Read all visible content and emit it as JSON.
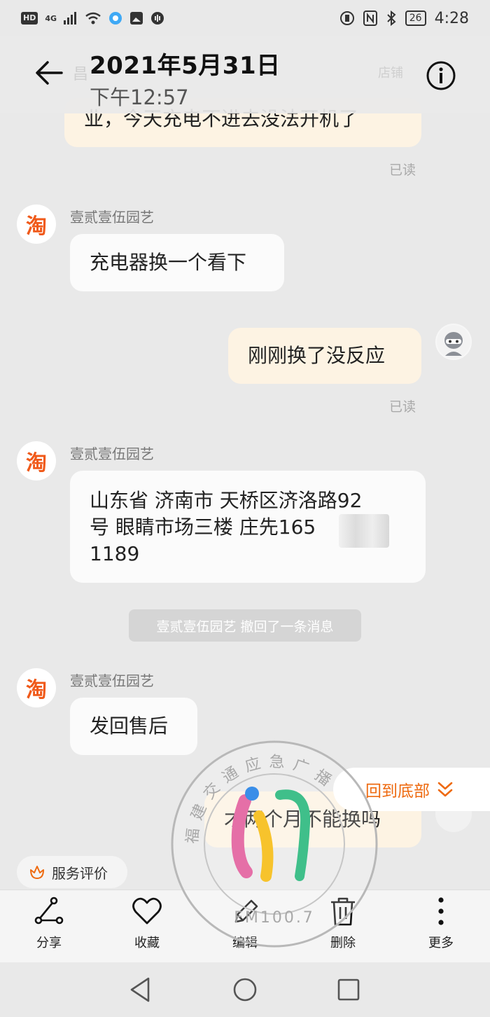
{
  "status_bar": {
    "left_chips": [
      "HD",
      "4G"
    ],
    "battery": "26",
    "time": "4:28"
  },
  "header": {
    "title": "2021年5月31日",
    "subtitle": "下午12:57",
    "faded_name": "昌",
    "faded_right": "店铺"
  },
  "messages": {
    "m0_text": "业，今天充电不进去没法开机了",
    "m0_status": "已读",
    "m1_sender": "壹贰壹伍园艺",
    "m1_text": "充电器换一个看下",
    "m2_text": "刚刚换了没反应",
    "m2_status": "已读",
    "m3_sender": "壹贰壹伍园艺",
    "m3_line1": "山东省 济南市 天桥区济洛路92",
    "m3_line2": "号 眼睛市场三楼 庄先165",
    "m3_line3": "1189",
    "recall_notice": "壹贰壹伍园艺 撤回了一条消息",
    "m4_sender": "壹贰壹伍园艺",
    "m4_text": "发回售后",
    "m5_text": "才两个月不能换吗",
    "shop_avatar_char": "淘"
  },
  "back_to_bottom": "回到底部",
  "service_eval": "服务评价",
  "toolbar": {
    "share": "分享",
    "favorite": "收藏",
    "edit": "编辑",
    "delete": "删除",
    "more": "更多"
  },
  "watermark": {
    "arc_text": "福 建 交 通 应 急 广 播",
    "freq": "FM100.7"
  },
  "icons": {
    "back": "arrow-left-icon",
    "info": "info-icon",
    "share": "share-icon",
    "favorite": "heart-icon",
    "edit": "pencil-icon",
    "delete": "trash-icon",
    "more": "more-vertical-icon"
  },
  "colors": {
    "accent": "#ee6a10",
    "taobao_orange": "#f05a1a",
    "outgoing_bubble": "#fdf3e3"
  }
}
